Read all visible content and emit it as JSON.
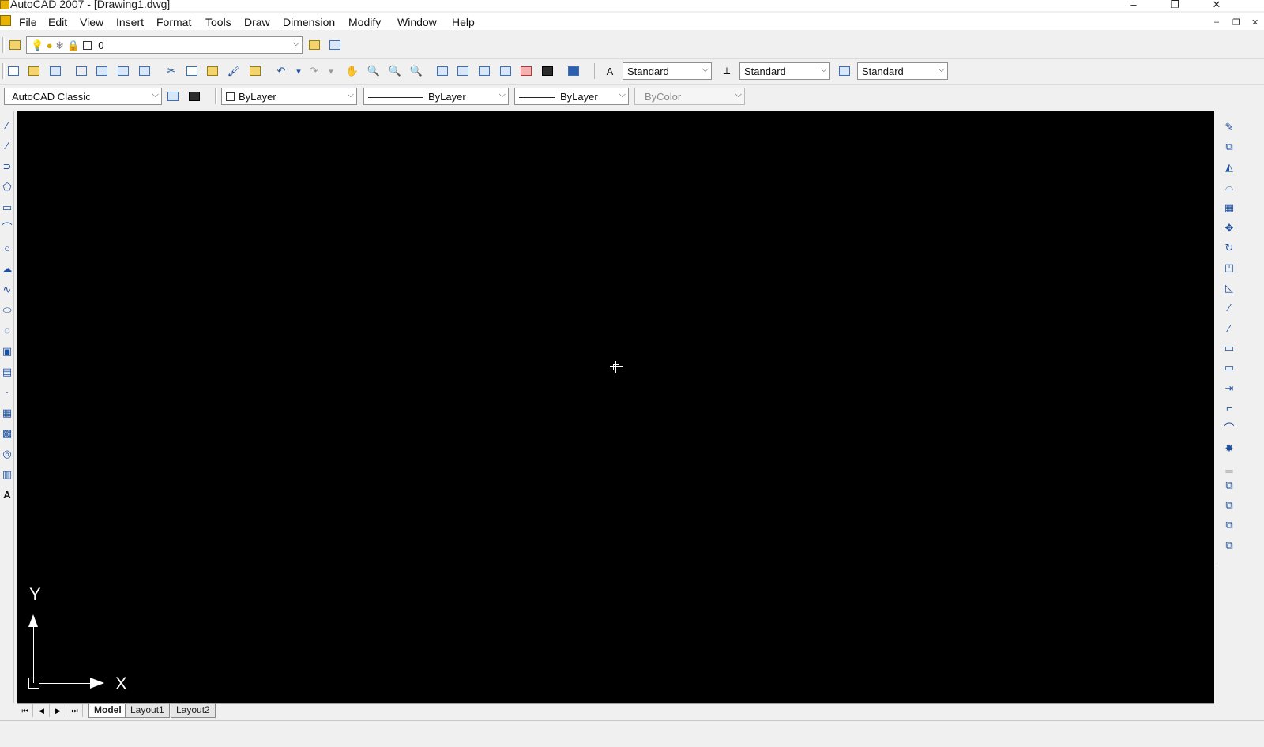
{
  "window": {
    "title": "AutoCAD 2007 - [Drawing1.dwg]",
    "controls": {
      "minimize": "–",
      "restore": "❐",
      "close": "✕"
    }
  },
  "menubar": {
    "items": [
      {
        "label": "File"
      },
      {
        "label": "Edit"
      },
      {
        "label": "View"
      },
      {
        "label": "Insert"
      },
      {
        "label": "Format"
      },
      {
        "label": "Tools"
      },
      {
        "label": "Draw"
      },
      {
        "label": "Dimension"
      },
      {
        "label": "Modify"
      },
      {
        "label": "Window"
      },
      {
        "label": "Help"
      }
    ],
    "doc_controls": {
      "minimize": "–",
      "restore": "❐",
      "close": "✕"
    }
  },
  "layers": {
    "current_layer": "0"
  },
  "styles": {
    "text_style": "Standard",
    "dim_style": "Standard",
    "table_style": "Standard"
  },
  "workspace": {
    "current": "AutoCAD Classic"
  },
  "properties": {
    "color": "ByLayer",
    "linetype": "ByLayer",
    "lineweight": "ByLayer",
    "plotstyle": "ByColor"
  },
  "ucs": {
    "x_label": "X",
    "y_label": "Y"
  },
  "layout_tabs": {
    "tabs": [
      {
        "label": "Model"
      },
      {
        "label": "Layout1"
      },
      {
        "label": "Layout2"
      }
    ],
    "nav": {
      "first": "⏮",
      "prev": "◀",
      "next": "▶",
      "last": "⏭"
    }
  },
  "colors": {
    "drawing_bg": "#000000",
    "toolbar_bg": "#f0f0f0",
    "icon_blue": "#1b4fa0"
  }
}
